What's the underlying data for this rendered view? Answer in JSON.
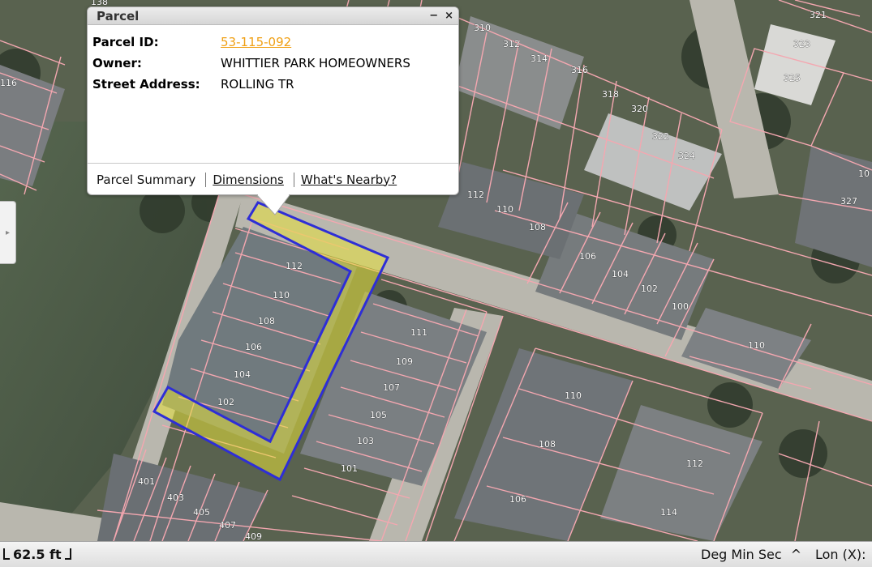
{
  "popup": {
    "title": "Parcel",
    "minimize_symbol": "−",
    "close_symbol": "×",
    "attributes": [
      {
        "key": "Parcel ID:",
        "value": "53-115-092",
        "is_link": true
      },
      {
        "key": "Owner:",
        "value": "WHITTIER PARK HOMEOWNERS",
        "is_link": false
      },
      {
        "key": "Street Address:",
        "value": "ROLLING TR",
        "is_link": false
      }
    ],
    "tabs": [
      {
        "label": "Parcel Summary",
        "is_link": false
      },
      {
        "label": "Dimensions",
        "is_link": true
      },
      {
        "label": "What's Nearby?",
        "is_link": true
      }
    ],
    "link_color": "#f0a015"
  },
  "map": {
    "parcel_line_color": "#f4a7b0",
    "selected_outline_color": "#2e2ed6",
    "selected_fill_color": "#e8e23a",
    "lot_numbers": [
      "138",
      "116",
      "310",
      "312",
      "314",
      "316",
      "318",
      "320",
      "322",
      "324",
      "321",
      "323",
      "325",
      "10",
      "327",
      "112",
      "110",
      "108",
      "106",
      "104",
      "102",
      "100",
      "110",
      "112",
      "110",
      "108",
      "106",
      "104",
      "102",
      "111",
      "109",
      "107",
      "105",
      "103",
      "101",
      "110",
      "108",
      "106",
      "112",
      "114",
      "401",
      "403",
      "405",
      "407",
      "409"
    ]
  },
  "status_bar": {
    "scale_label": "62.5 ft",
    "coord_format": "Deg Min Sec",
    "caret": "^",
    "coord_axis": "Lon (X):"
  },
  "icons": {
    "side_handle": "chevron-right-icon"
  }
}
